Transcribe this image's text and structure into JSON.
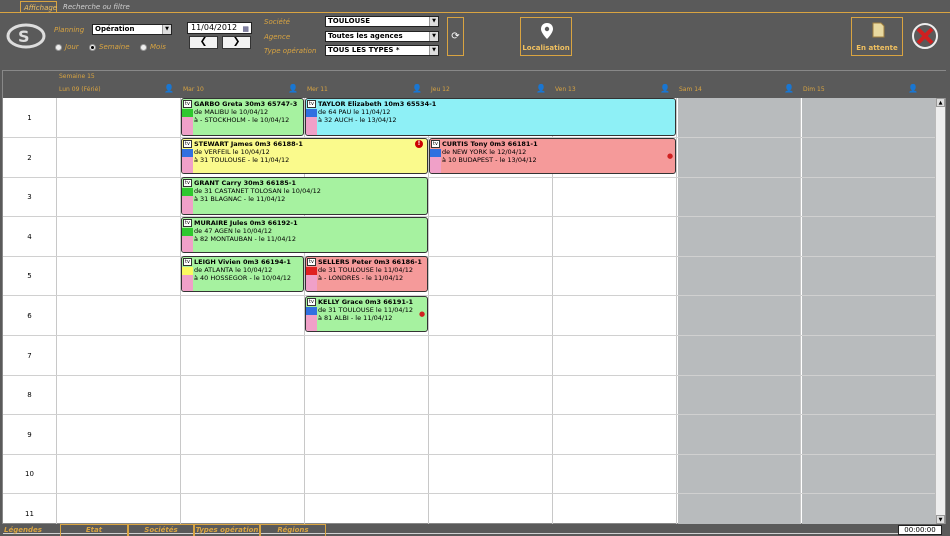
{
  "tabs": [
    {
      "label": "Affichage"
    },
    {
      "label": "Recherche ou filtre"
    }
  ],
  "filters": {
    "planning_label": "Planning",
    "planning_value": "Opération",
    "radios": [
      {
        "label": "Jour",
        "selected": false
      },
      {
        "label": "Semaine",
        "selected": true
      },
      {
        "label": "Mois",
        "selected": false
      }
    ],
    "date": "11/04/2012",
    "societe_label": "Société",
    "societe_value": "TOULOUSE",
    "agence_label": "Agence",
    "agence_value": "Toutes les agences",
    "type_label": "Type opération",
    "type_value": "TOUS LES TYPES *"
  },
  "buttons": {
    "localisation": "Localisation",
    "en_attente": "En attente"
  },
  "week_label": "Semaine 15",
  "days": [
    "Lun 09 (Férié)",
    "Mar 10",
    "Mer 11",
    "Jeu 12",
    "Ven 13",
    "Sam 14",
    "Dim 15"
  ],
  "rows": [
    "1",
    "2",
    "3",
    "4",
    "5",
    "6",
    "7",
    "8",
    "9",
    "10",
    "11"
  ],
  "events": [
    {
      "title": "GARBO Greta 30m3 65747-3",
      "line2": "de MALIBU le 10/04/12",
      "line3": "à - STOCKHOLM - le 10/04/12",
      "color": "#a6f2a0",
      "strip": [
        "#2ec82e",
        "#f0a0c8"
      ]
    },
    {
      "title": "TAYLOR Elizabeth 10m3 65534-1",
      "line2": "de 64 PAU le 11/04/12",
      "line3": "à 32 AUCH - le 13/04/12",
      "color": "#8ef0f6",
      "strip": [
        "#3070e0",
        "#f0a0c8"
      ]
    },
    {
      "title": "STEWART James 0m3 66188-1",
      "line2": "de VERFEIL le 10/04/12",
      "line3": "à 31 TOULOUSE - le 11/04/12",
      "color": "#fafa8c",
      "strip": [
        "#3070e0",
        "#f0a0c8"
      ]
    },
    {
      "title": "CURTIS Tony 0m3 66181-1",
      "line2": "de NEW YORK le 12/04/12",
      "line3": "à 10 BUDAPEST - le 13/04/12",
      "color": "#f59a9a",
      "strip": [
        "#3070e0",
        "#f0a0c8"
      ]
    },
    {
      "title": "GRANT Carry 30m3 66185-1",
      "line2": "de 31 CASTANET TOLOSAN le 10/04/12",
      "line3": "à 31 BLAGNAC - le 11/04/12",
      "color": "#a6f2a0",
      "strip": [
        "#2ec82e",
        "#f0a0c8"
      ]
    },
    {
      "title": "MURAIRE Jules 0m3 66192-1",
      "line2": "de 47 AGEN le 10/04/12",
      "line3": "à 82 MONTAUBAN - le 11/04/12",
      "color": "#a6f2a0",
      "strip": [
        "#2ec82e",
        "#f0a0c8"
      ]
    },
    {
      "title": "LEIGH Vivien 0m3 66194-1",
      "line2": "de ATLANTA le 10/04/12",
      "line3": "à 40 HOSSEGOR - le 10/04/12",
      "color": "#a6f2a0",
      "strip": [
        "#fafa60",
        "#f0a0c8"
      ]
    },
    {
      "title": "SELLERS Peter 0m3 66186-1",
      "line2": "de 31 TOULOUSE le 11/04/12",
      "line3": "à - LONDRES - le 11/04/12",
      "color": "#f59a9a",
      "strip": [
        "#e02020",
        "#f0a0c8"
      ]
    },
    {
      "title": "KELLY Grace 0m3 66191-1",
      "line2": "de 31 TOULOUSE le 11/04/12",
      "line3": "à 81 ALBI - le 11/04/12",
      "color": "#a6f2a0",
      "strip": [
        "#3070e0",
        "#f0a0c8"
      ]
    }
  ],
  "footer": {
    "legendes": "Légendes",
    "etat": "Etat",
    "societes": "Sociétés",
    "types": "Types opération",
    "regions": "Régions",
    "clock": "00:00:00"
  }
}
